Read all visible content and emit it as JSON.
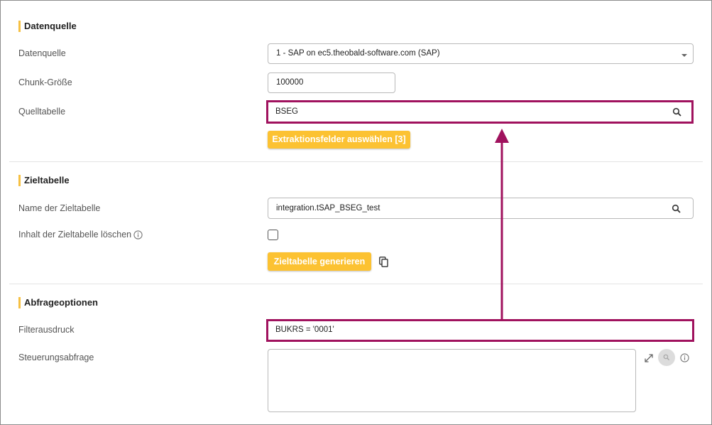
{
  "sections": {
    "source": {
      "title": "Datenquelle"
    },
    "target": {
      "title": "Zieltabelle"
    },
    "query": {
      "title": "Abfrageoptionen"
    }
  },
  "source": {
    "datasource_label": "Datenquelle",
    "datasource_value": "1 - SAP on ec5.theobald-software.com (SAP)",
    "chunk_label": "Chunk-Größe",
    "chunk_value": "100000",
    "table_label": "Quelltabelle",
    "table_value": "BSEG",
    "select_fields_button": "Extraktionsfelder auswählen [3]"
  },
  "target": {
    "name_label": "Name der Zieltabelle",
    "name_value": "integration.tSAP_BSEG_test",
    "clear_label": "Inhalt der Zieltabelle löschen",
    "clear_checked": false,
    "generate_button": "Zieltabelle generieren"
  },
  "query": {
    "filter_label": "Filterausdruck",
    "filter_value": "BUKRS = '0001'",
    "control_label": "Steuerungsabfrage",
    "control_value": ""
  },
  "colors": {
    "accent": "#fcc232",
    "highlight": "#a0125e",
    "section_bar": "#f6c042"
  },
  "icons": [
    "search-icon",
    "info-icon",
    "copy-icon",
    "expand-icon",
    "chevron-down-icon"
  ]
}
